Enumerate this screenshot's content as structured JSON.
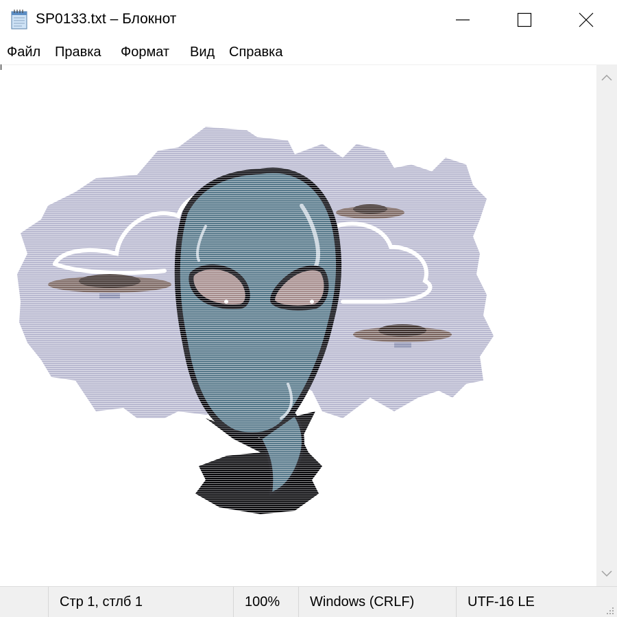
{
  "window": {
    "title": "SP0133.txt – Блокнот",
    "app_icon": "notepad-icon",
    "controls": [
      "minimize-icon",
      "maximize-icon",
      "close-icon"
    ]
  },
  "menu": {
    "items": [
      {
        "label": "Файл"
      },
      {
        "label": "Правка"
      },
      {
        "label": "Формат"
      },
      {
        "label": "Вид"
      },
      {
        "label": "Справка"
      }
    ]
  },
  "editor": {
    "content": "ASCII-art image of an alien head with flying saucers and clouds",
    "colors": {
      "sky_band": "#b9b9d0",
      "cloud_outline": "#ffffff",
      "head": "#56788a",
      "head_outline": "#0a0a10",
      "eye": "#a58c8c",
      "ufo": "#6e5a55",
      "shadow": "#050508"
    }
  },
  "scrollbar": {
    "up_icon": "chevron-up-icon",
    "down_icon": "chevron-down-icon"
  },
  "status": {
    "position": "Стр 1, стлб 1",
    "zoom": "100%",
    "line_endings": "Windows (CRLF)",
    "encoding": "UTF-16 LE"
  }
}
